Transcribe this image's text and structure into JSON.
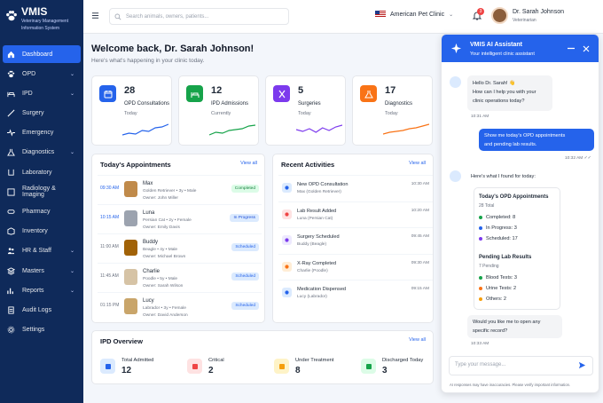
{
  "brand": {
    "name": "VMIS",
    "subtitle_line1": "Veterinary Management",
    "subtitle_line2": "Information System"
  },
  "sidebar": {
    "items": [
      {
        "label": "Dashboard",
        "icon": "home-icon",
        "chevron": false
      },
      {
        "label": "OPD",
        "icon": "paw-icon",
        "chevron": true
      },
      {
        "label": "IPD",
        "icon": "bed-icon",
        "chevron": true
      },
      {
        "label": "Surgery",
        "icon": "scalpel-icon",
        "chevron": false
      },
      {
        "label": "Emergency",
        "icon": "pulse-icon",
        "chevron": false
      },
      {
        "label": "Diagnostics",
        "icon": "flask-icon",
        "chevron": true
      },
      {
        "label": "Laboratory",
        "icon": "beaker-icon",
        "chevron": false
      },
      {
        "label": "Radiology & Imaging",
        "icon": "xray-icon",
        "chevron": false
      },
      {
        "label": "Pharmacy",
        "icon": "pill-icon",
        "chevron": false
      },
      {
        "label": "Inventory",
        "icon": "box-icon",
        "chevron": false
      },
      {
        "label": "HR & Staff",
        "icon": "people-icon",
        "chevron": true
      },
      {
        "label": "Masters",
        "icon": "layers-icon",
        "chevron": true
      },
      {
        "label": "Reports",
        "icon": "chart-icon",
        "chevron": true
      },
      {
        "label": "Audit Logs",
        "icon": "log-icon",
        "chevron": false
      },
      {
        "label": "Settings",
        "icon": "gear-icon",
        "chevron": false
      }
    ]
  },
  "topbar": {
    "search_placeholder": "Search animals, owners, patients...",
    "clinic": "American Pet Clinic",
    "notifications": "3",
    "user_name": "Dr. Sarah Johnson",
    "user_role": "Veterinarian"
  },
  "welcome": {
    "title": "Welcome back, Dr. Sarah Johnson!",
    "subtitle": "Here's what's happening in your clinic today."
  },
  "stats": [
    {
      "value": "28",
      "label": "OPD Consultations",
      "sub": "Today",
      "color": "#2563eb"
    },
    {
      "value": "12",
      "label": "IPD Admissions",
      "sub": "Currently",
      "color": "#16a34a"
    },
    {
      "value": "5",
      "label": "Surgeries",
      "sub": "Today",
      "color": "#7c3aed"
    },
    {
      "value": "17",
      "label": "Diagnostics",
      "sub": "Today",
      "color": "#f97316"
    }
  ],
  "appointments": {
    "title": "Today's Appointments",
    "view_all": "View all",
    "rows": [
      {
        "time": "09:30 AM",
        "name": "Max",
        "detail": "Golden Retriever • 3y • Male",
        "owner": "Owner: John Miller",
        "status": "Completed"
      },
      {
        "time": "10:15 AM",
        "name": "Luna",
        "detail": "Persian Cat • 2y • Female",
        "owner": "Owner: Emily Davis",
        "status": "In Progress"
      },
      {
        "time": "11:00 AM",
        "name": "Buddy",
        "detail": "Beagle • 4y • Male",
        "owner": "Owner: Michael Brown",
        "status": "Scheduled"
      },
      {
        "time": "11:45 AM",
        "name": "Charlie",
        "detail": "Poodle • 5y • Male",
        "owner": "Owner: Sarah Wilson",
        "status": "Scheduled"
      },
      {
        "time": "01:15 PM",
        "name": "Lucy",
        "detail": "Labrador • 3y • Female",
        "owner": "Owner: David Anderson",
        "status": "Scheduled"
      }
    ]
  },
  "activities": {
    "title": "Recent Activities",
    "view_all": "View all",
    "rows": [
      {
        "title": "New OPD Consultation",
        "sub": "Max (Golden Retriever)",
        "time": "10:30 AM",
        "icon": "stethoscope-icon"
      },
      {
        "title": "Lab Result Added",
        "sub": "Luna (Persian Cat)",
        "time": "10:20 AM",
        "icon": "flask-icon"
      },
      {
        "title": "Surgery Scheduled",
        "sub": "Buddy (Beagle)",
        "time": "09:45 AM",
        "icon": "scissors-icon"
      },
      {
        "title": "X-Ray Completed",
        "sub": "Charlie (Poodle)",
        "time": "09:30 AM",
        "icon": "xray-icon"
      },
      {
        "title": "Medication Dispensed",
        "sub": "Lucy (Labrador)",
        "time": "09:15 AM",
        "icon": "pill-icon"
      }
    ]
  },
  "ipd": {
    "title": "IPD Overview",
    "view_all": "View all",
    "items": [
      {
        "label": "Total Admitted",
        "value": "12",
        "icon": "bed-icon"
      },
      {
        "label": "Critical",
        "value": "2",
        "icon": "heart-icon"
      },
      {
        "label": "Under Treatment",
        "value": "8",
        "icon": "medicine-icon"
      },
      {
        "label": "Discharged Today",
        "value": "3",
        "icon": "flask-icon"
      }
    ]
  },
  "assistant": {
    "title": "VMIS AI Assistant",
    "subtitle": "Your intelligent clinic assistant",
    "greeting_1": "Hello Dr. Sarah! 👋",
    "greeting_2": "How can I help you with your",
    "greeting_3": "clinic operations today?",
    "time_1": "10:31 AM",
    "user_msg_1": "Show me today's OPD appointments",
    "user_msg_2": "and pending lab results.",
    "time_2": "10:32 AM ✓✓",
    "reply": "Here's what I found for today:",
    "opd_title": "Today's OPD Appointments",
    "opd_total": "28 Total",
    "opd_items": [
      "Completed: 8",
      "In Progress: 3",
      "Scheduled: 17"
    ],
    "lab_title": "Pending Lab Results",
    "lab_total": "7 Pending",
    "lab_items": [
      "Blood Tests: 3",
      "Urine Tests: 2",
      "Others: 2"
    ],
    "followup_1": "Would you like me to open any",
    "followup_2": "specific record?",
    "time_3": "10:33 AM",
    "input_placeholder": "Type your message...",
    "disclaimer": "AI responses may have inaccuracies. Please verify important information."
  }
}
